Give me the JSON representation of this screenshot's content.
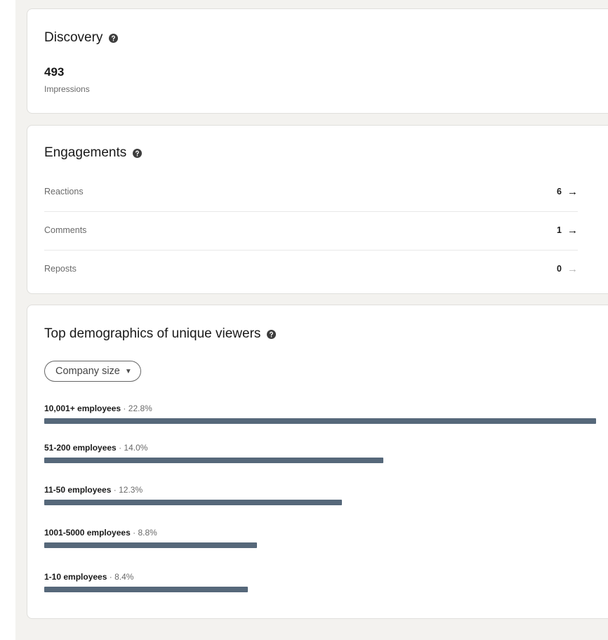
{
  "discovery": {
    "title": "Discovery",
    "value": "493",
    "label": "Impressions",
    "help_icon": "question-circle-icon"
  },
  "engagements": {
    "title": "Engagements",
    "help_icon": "question-circle-icon",
    "rows": [
      {
        "label": "Reactions",
        "value": "6",
        "arrow": "→",
        "arrow_color": "#000000"
      },
      {
        "label": "Comments",
        "value": "1",
        "arrow": "→",
        "arrow_color": "#000000"
      },
      {
        "label": "Reposts",
        "value": "0",
        "arrow": "→",
        "arrow_color": "#b3b3b3"
      }
    ]
  },
  "demographics": {
    "title": "Top demographics of unique viewers",
    "help_icon": "question-circle-icon",
    "filter": {
      "label": "Company size",
      "caret": "▼"
    },
    "separator": "·",
    "bar_color": "#56687a",
    "items": [
      {
        "name": "10,001+ employees",
        "percent": "22.8%",
        "fraction": 0.228
      },
      {
        "name": "51-200 employees",
        "percent": "14.0%",
        "fraction": 0.14
      },
      {
        "name": "11-50 employees",
        "percent": "12.3%",
        "fraction": 0.123
      },
      {
        "name": "1001-5000 employees",
        "percent": "8.8%",
        "fraction": 0.088
      },
      {
        "name": "1-10 employees",
        "percent": "8.4%",
        "fraction": 0.084
      }
    ]
  },
  "colors": {
    "page_background": "#f3f2ef",
    "card_background": "#ffffff",
    "text_primary": "rgba(0,0,0,0.9)",
    "text_secondary": "rgba(0,0,0,0.6)"
  }
}
